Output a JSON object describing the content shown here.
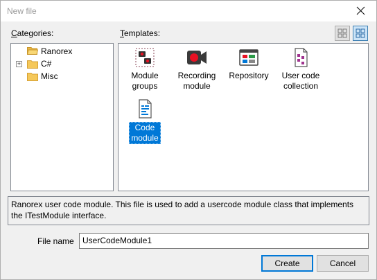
{
  "window": {
    "title": "New file"
  },
  "labels": {
    "categories_prefix": "C",
    "categories_rest": "ategories:",
    "templates_prefix": "T",
    "templates_rest": "emplates:",
    "file_name": "File name"
  },
  "categories": [
    {
      "label": "Ranorex",
      "selected": true,
      "expandable": false
    },
    {
      "label": "C#",
      "selected": false,
      "expandable": true
    },
    {
      "label": "Misc",
      "selected": false,
      "expandable": false
    }
  ],
  "templates": [
    {
      "line1": "Module",
      "line2": "groups",
      "icon": "module-group-icon"
    },
    {
      "line1": "Recording",
      "line2": "module",
      "icon": "recording-module-icon"
    },
    {
      "line1": "Repository",
      "line2": "",
      "icon": "repository-icon"
    },
    {
      "line1": "User code",
      "line2": "collection",
      "icon": "user-code-collection-icon"
    },
    {
      "line1": "Code",
      "line2": "module",
      "icon": "code-module-icon",
      "selected": true
    }
  ],
  "description": "Ranorex user code module. This file is used to add a usercode module class that implements the ITestModule interface.",
  "file_name_value": "UserCodeModule1",
  "buttons": {
    "create": "Create",
    "cancel": "Cancel"
  },
  "colors": {
    "selection": "#0078d7",
    "record_red": "#e81123"
  }
}
